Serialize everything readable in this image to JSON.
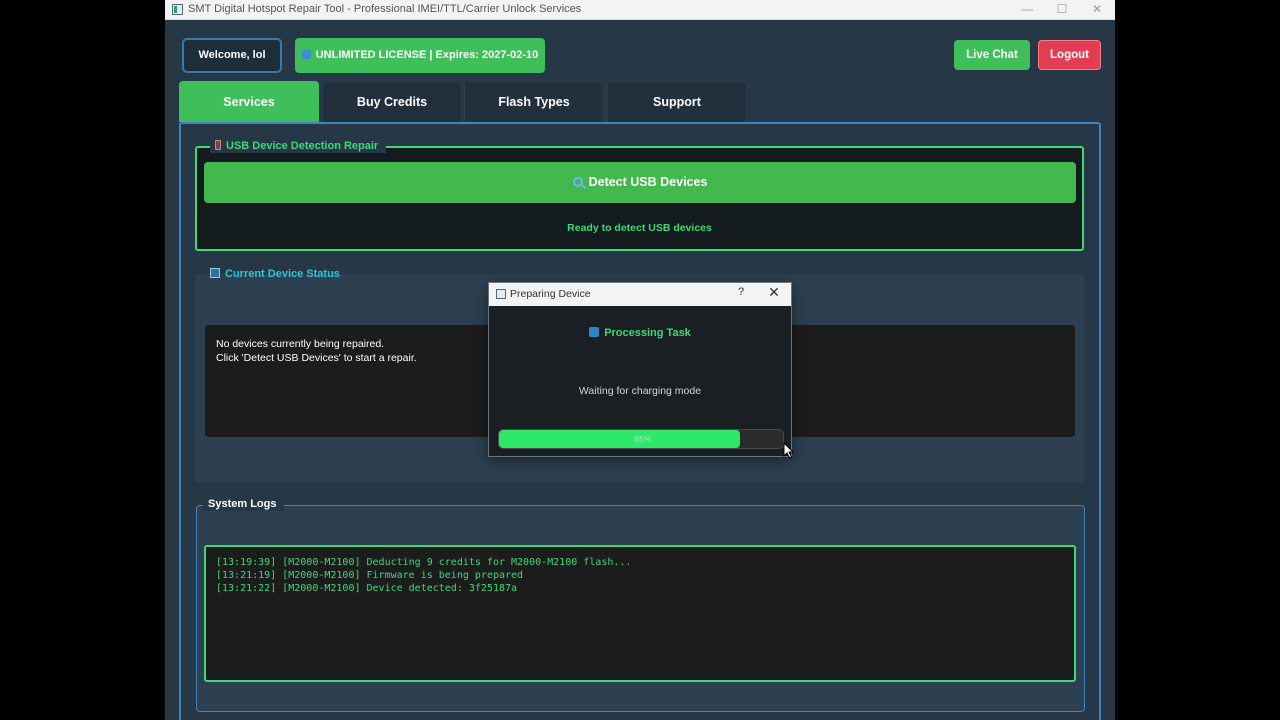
{
  "window": {
    "title": "SMT Digital Hotspot Repair Tool - Professional IMEI/TTL/Carrier Unlock Services",
    "minimize_glyph": "—",
    "maximize_glyph": "☐",
    "close_glyph": "✕"
  },
  "header": {
    "welcome_label": "Welcome, lol",
    "license_label": "UNLIMITED LICENSE | Expires: 2027-02-10",
    "live_chat_label": "Live Chat",
    "logout_label": "Logout"
  },
  "tabs": [
    {
      "label": "Services",
      "active": true
    },
    {
      "label": "Buy Credits",
      "active": false
    },
    {
      "label": "Flash Types",
      "active": false
    },
    {
      "label": "Support",
      "active": false
    }
  ],
  "usb_section": {
    "legend": "USB Device Detection  Repair",
    "detect_button_label": "Detect USB Devices",
    "status_text": "Ready to detect USB devices"
  },
  "device_status": {
    "legend": "Current Device Status",
    "lines": [
      "No devices currently being repaired.",
      "Click 'Detect USB Devices' to start a repair."
    ]
  },
  "system_logs": {
    "legend": "System Logs",
    "lines": [
      "[13:19:39] [M2000-M2100] Deducting 9 credits for M2000-M2100 flash...",
      "[13:21:19] [M2000-M2100] Firmware is being prepared",
      "[13:21:22] [M2000-M2100] Device detected: 3f25187a"
    ]
  },
  "dialog": {
    "title": "Preparing Device",
    "help_glyph": "?",
    "close_glyph": "✕",
    "heading": "Processing Task",
    "message": "Waiting for charging mode",
    "progress_percent": 85,
    "progress_text": "85%"
  },
  "colors": {
    "accent_green": "#3fbf5a",
    "log_green": "#3fd878",
    "logout_red": "#e23d52",
    "panel_blue_border": "#3d85c0",
    "background": "#263746"
  },
  "icons": {
    "usb_legend": "phone-icon",
    "detect_button": "magnifier-icon",
    "status_legend": "chart-icon",
    "dialog_heading": "processing-icon",
    "license": "license-icon"
  }
}
